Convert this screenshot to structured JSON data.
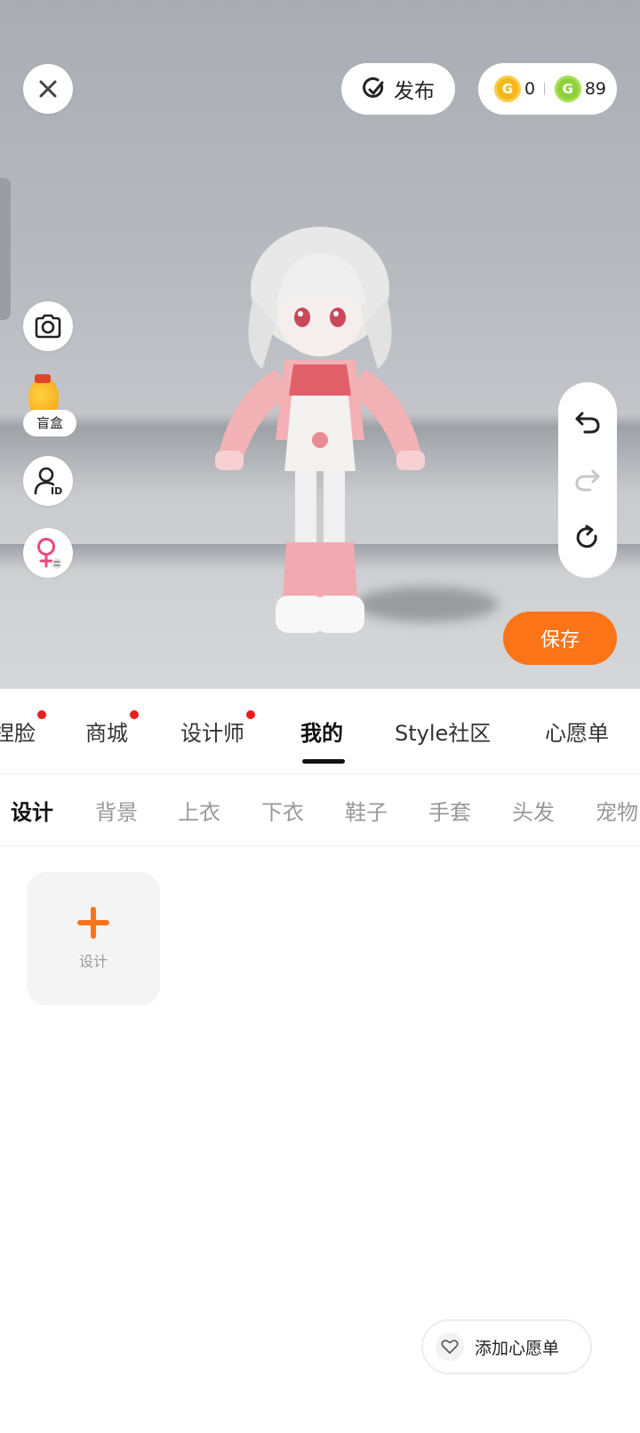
{
  "header": {
    "publish_label": "发布",
    "gold_coins": "0",
    "green_coins": "89",
    "gold_coin_icon": "G",
    "green_coin_icon": "G"
  },
  "left_tools": {
    "blindbox_label": "盲盒"
  },
  "save_label": "保存",
  "main_tabs": [
    {
      "label": "捏脸",
      "dot": true
    },
    {
      "label": "商城",
      "dot": true
    },
    {
      "label": "设计师",
      "dot": true
    },
    {
      "label": "我的",
      "dot": false,
      "active": true
    },
    {
      "label": "Style社区",
      "dot": false
    },
    {
      "label": "心愿单",
      "dot": false
    }
  ],
  "sub_tabs": [
    {
      "label": "设计",
      "active": true
    },
    {
      "label": "背景"
    },
    {
      "label": "上衣"
    },
    {
      "label": "下衣"
    },
    {
      "label": "鞋子"
    },
    {
      "label": "手套"
    },
    {
      "label": "头发"
    },
    {
      "label": "宠物"
    }
  ],
  "design_card_label": "设计",
  "wishlist_label": "添加心愿单",
  "colors": {
    "accent": "#fb7418",
    "dot": "#e81e1e"
  }
}
